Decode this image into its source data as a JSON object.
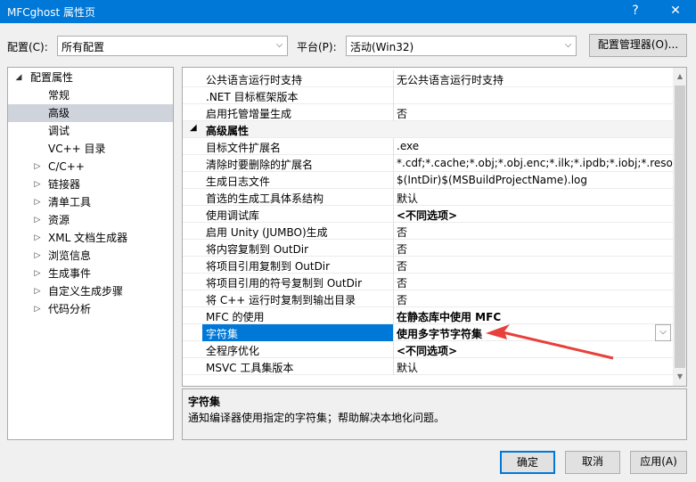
{
  "window": {
    "title": "MFCghost 属性页",
    "help_glyph": "?",
    "close_glyph": "✕"
  },
  "config": {
    "config_label": "配置(C):",
    "config_value": "所有配置",
    "platform_label": "平台(P):",
    "platform_value": "活动(Win32)",
    "manager_button": "配置管理器(O)..."
  },
  "tree": {
    "items": [
      {
        "label": "配置属性",
        "expander": "◢"
      },
      {
        "label": "常规",
        "expander": ""
      },
      {
        "label": "高级",
        "expander": ""
      },
      {
        "label": "调试",
        "expander": ""
      },
      {
        "label": "VC++ 目录",
        "expander": ""
      },
      {
        "label": "C/C++",
        "expander": "▷"
      },
      {
        "label": "链接器",
        "expander": "▷"
      },
      {
        "label": "清单工具",
        "expander": "▷"
      },
      {
        "label": "资源",
        "expander": "▷"
      },
      {
        "label": "XML 文档生成器",
        "expander": "▷"
      },
      {
        "label": "浏览信息",
        "expander": "▷"
      },
      {
        "label": "生成事件",
        "expander": "▷"
      },
      {
        "label": "自定义生成步骤",
        "expander": "▷"
      },
      {
        "label": "代码分析",
        "expander": "▷"
      }
    ]
  },
  "grid": {
    "rows": [
      {
        "name": "公共语言运行时支持",
        "value": "无公共语言运行时支持"
      },
      {
        "name": ".NET 目标框架版本",
        "value": ""
      },
      {
        "name": "启用托管增量生成",
        "value": "否"
      },
      {
        "name": "高级属性",
        "value": "",
        "expander": "◢"
      },
      {
        "name": "目标文件扩展名",
        "value": ".exe"
      },
      {
        "name": "清除时要删除的扩展名",
        "value": "*.cdf;*.cache;*.obj;*.obj.enc;*.ilk;*.ipdb;*.iobj;*.resources"
      },
      {
        "name": "生成日志文件",
        "value": "$(IntDir)$(MSBuildProjectName).log"
      },
      {
        "name": "首选的生成工具体系结构",
        "value": "默认"
      },
      {
        "name": "使用调试库",
        "value": "<不同选项>"
      },
      {
        "name": "启用 Unity (JUMBO)生成",
        "value": "否"
      },
      {
        "name": "将内容复制到 OutDir",
        "value": "否"
      },
      {
        "name": "将项目引用复制到 OutDir",
        "value": "否"
      },
      {
        "name": "将项目引用的符号复制到 OutDir",
        "value": "否"
      },
      {
        "name": "将 C++ 运行时复制到输出目录",
        "value": "否"
      },
      {
        "name": "MFC 的使用",
        "value": "在静态库中使用 MFC"
      },
      {
        "name": "字符集",
        "value": "使用多字节字符集"
      },
      {
        "name": "全程序优化",
        "value": "<不同选项>"
      },
      {
        "name": "MSVC 工具集版本",
        "value": "默认"
      }
    ]
  },
  "description": {
    "title": "字符集",
    "text": "通知编译器使用指定的字符集；帮助解决本地化问题。"
  },
  "buttons": {
    "ok": "确定",
    "cancel": "取消",
    "apply": "应用(A)"
  },
  "icons": {
    "combo_arrow": "⌵",
    "scroll_up": "▲",
    "scroll_down": "▼"
  },
  "colors": {
    "accent": "#0078d7",
    "annotation": "#e8403a"
  }
}
